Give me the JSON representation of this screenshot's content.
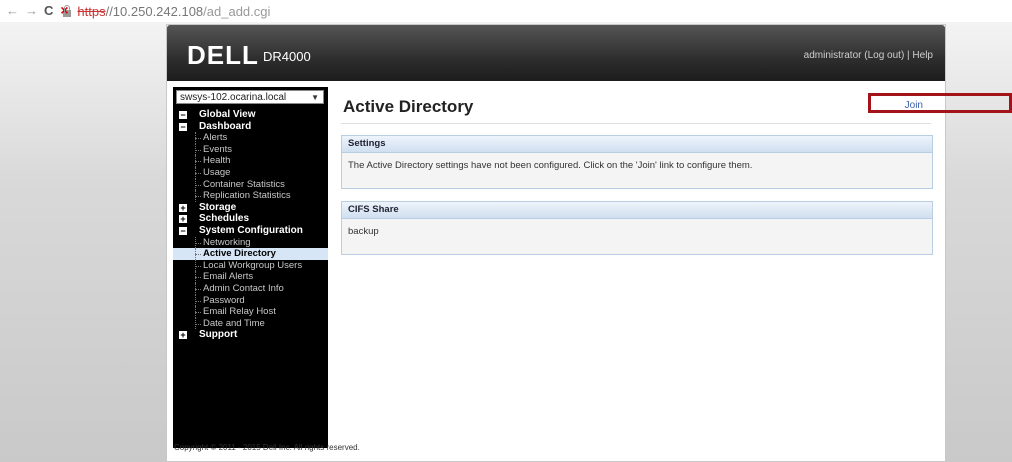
{
  "browser": {
    "url_scheme": "https",
    "url_host": "//10.250.242.108",
    "url_path": "/ad_add.cgi"
  },
  "header": {
    "logo": "DELL",
    "model": "DR4000",
    "user_links": "administrator (Log out)  |  Help"
  },
  "sidebar": {
    "system_select": "swsys-102.ocarina.local",
    "tree": {
      "global_view": "Global View",
      "dashboard": "Dashboard",
      "dashboard_items": [
        "Alerts",
        "Events",
        "Health",
        "Usage",
        "Container Statistics",
        "Replication Statistics"
      ],
      "storage": "Storage",
      "schedules": "Schedules",
      "system_configuration": "System Configuration",
      "sysconf_items": [
        "Networking",
        "Active Directory",
        "Local Workgroup Users",
        "Email Alerts",
        "Admin Contact Info",
        "Password",
        "Email Relay Host",
        "Date and Time"
      ],
      "support": "Support"
    }
  },
  "main": {
    "title": "Active Directory",
    "join_link": "Join",
    "settings_panel": {
      "title": "Settings",
      "text": "The Active Directory settings have not been configured. Click on the 'Join' link to configure them."
    },
    "cifs_panel": {
      "title": "CIFS Share",
      "text": "backup"
    }
  },
  "footer": {
    "copyright": "Copyright © 2011 - 2015 Dell Inc. All rights reserved."
  },
  "colors": {
    "highlight_box": "#a3131a",
    "active_item_bg": "#d6e6f6",
    "link": "#3a5ea8"
  }
}
